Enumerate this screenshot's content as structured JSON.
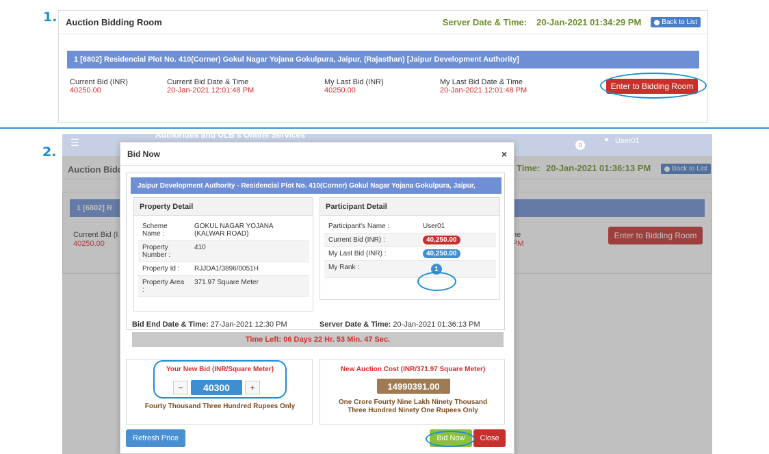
{
  "step1": {
    "number": "1.",
    "title": "Auction Bidding Room",
    "server_label": "Server Date & Time:",
    "server_time": "20-Jan-2021 01:34:29 PM",
    "back_label": "Back to List",
    "property": "1  [6802] Residencial Plot No. 410(Corner) Gokul Nagar Yojana Gokulpura, Jaipur, (Rajasthan) [Jaipur Development Authority]",
    "current_bid_label": "Current Bid (INR)",
    "current_bid_value": "40250.00",
    "current_date_label": "Current Bid Date & Time",
    "current_date_value": "20-Jan-2021 12:01:48 PM",
    "last_bid_label": "My Last Bid (INR)",
    "last_bid_value": "40250.00",
    "last_date_label": "My Last Bid Date & Time",
    "last_date_value": "20-Jan-2021 12:01:48 PM",
    "enter_button": "Enter to Bidding Room"
  },
  "step2": {
    "number": "2.",
    "bg_nav_text": "Authorities and ULB's Online Services",
    "bg_user": "User01",
    "bg_notify_count": "0",
    "bg_title": "Auction Bidd",
    "bg_time_label": "Time:",
    "bg_server_time": "20-Jan-2021 01:36:13 PM",
    "bg_back_label": "Back to List",
    "bg_property": "1  [6802] R",
    "bg_current_bid_label": "Current Bid (I",
    "bg_current_bid_value": "40250.00",
    "bg_col_frag": "ne",
    "bg_col_frag2": "PM",
    "bg_enter_button": "Enter to Bidding Room"
  },
  "modal": {
    "title": "Bid Now",
    "close": "×",
    "banner": "Jaipur Development Authority - Residencial Plot No. 410(Corner) Gokul Nagar Yojana Gokulpura, Jaipur,",
    "property_detail_head": "Property Detail",
    "participant_detail_head": "Participant Detail",
    "scheme_label": "Scheme Name :",
    "scheme_value": "GOKUL NAGAR YOJANA (KALWAR ROAD)",
    "prop_num_label": "Property Number :",
    "prop_num_value": "410",
    "prop_id_label": "Property Id :",
    "prop_id_value": "RJJDA1/3896/0051H",
    "prop_area_label": "Property Area :",
    "prop_area_value": "371.97  Square Meter",
    "p_name_label": "Participant's Name :",
    "p_name_value": "User01",
    "p_current_label": "Current Bid (INR) :",
    "p_current_value": "40,250.00",
    "p_last_label": "My Last Bid (INR) :",
    "p_last_value": "40,250.00",
    "p_rank_label": "My Rank :",
    "p_rank_value": "1",
    "bid_end_label": "Bid End Date & Time:",
    "bid_end_value": "27-Jan-2021 12:30 PM",
    "server_label": "Server Date & Time:",
    "server_value": "20-Jan-2021 01:36:13 PM",
    "time_left": "Time Left: 06 Days 22 Hr. 53 Min. 47 Sec.",
    "new_bid_label": "Your New Bid (INR/Square Meter)",
    "minus": "−",
    "plus": "+",
    "bid_value": "40300",
    "bid_words": "Fourty Thousand Three Hundred Rupees Only",
    "cost_label": "New Auction Cost (INR/371.97 Square Meter)",
    "cost_value": "14990391.00",
    "cost_words": "One Crore Fourty Nine Lakh Ninety Thousand Three Hundred Ninety One Rupees Only",
    "refresh_button": "Refresh Price",
    "bid_now_button": "Bid Now",
    "close_button": "Close"
  },
  "colors": {
    "accent_blue": "#1a8fd0",
    "bar_blue": "#6e8fd6",
    "danger": "#c9302c",
    "success": "#8cbf3f",
    "brown": "#a07a52",
    "green_text": "#6a8f2a"
  }
}
